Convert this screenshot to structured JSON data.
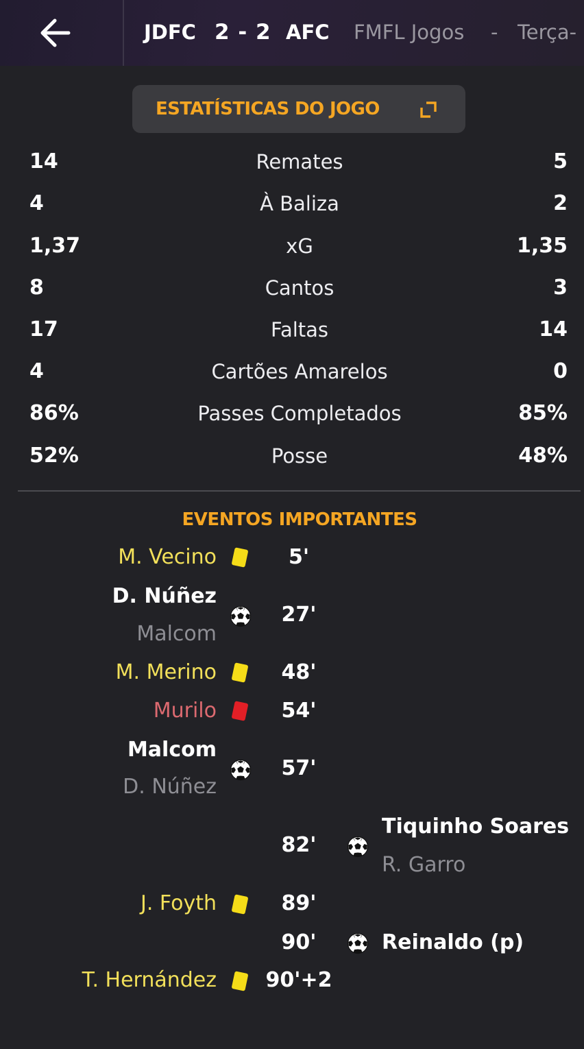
{
  "header": {
    "home_team": "JDFC",
    "score": "2 - 2",
    "away_team": "AFC",
    "competition": "FMFL Jogos",
    "separator": "-",
    "day": "Terça-"
  },
  "stats_tab": {
    "label": "ESTATÍSTICAS DO JOGO"
  },
  "stats": [
    {
      "label": "Remates",
      "home": "14",
      "away": "5"
    },
    {
      "label": "À Baliza",
      "home": "4",
      "away": "2"
    },
    {
      "label": "xG",
      "home": "1,37",
      "away": "1,35"
    },
    {
      "label": "Cantos",
      "home": "8",
      "away": "3"
    },
    {
      "label": "Faltas",
      "home": "17",
      "away": "14"
    },
    {
      "label": "Cartões Amarelos",
      "home": "4",
      "away": "0"
    },
    {
      "label": "Passes Completados",
      "home": "86%",
      "away": "85%"
    },
    {
      "label": "Posse",
      "home": "52%",
      "away": "48%"
    }
  ],
  "events_title": "EVENTOS IMPORTANTES",
  "events": [
    {
      "side": "home",
      "type": "yellow-card",
      "player": "M. Vecino",
      "time": "5'"
    },
    {
      "side": "home",
      "type": "goal",
      "player": "D. Núñez",
      "assist": "Malcom",
      "time": "27'"
    },
    {
      "side": "home",
      "type": "yellow-card",
      "player": "M. Merino",
      "time": "48'"
    },
    {
      "side": "home",
      "type": "red-card",
      "player": "Murilo",
      "time": "54'"
    },
    {
      "side": "home",
      "type": "goal",
      "player": "Malcom",
      "assist": "D. Núñez",
      "time": "57'"
    },
    {
      "side": "away",
      "type": "goal",
      "player": "Tiquinho Soares",
      "assist": "R. Garro",
      "time": "82'"
    },
    {
      "side": "home",
      "type": "yellow-card",
      "player": "J. Foyth",
      "time": "89'"
    },
    {
      "side": "away",
      "type": "goal",
      "player": "Reinaldo (p)",
      "time": "90'"
    },
    {
      "side": "home",
      "type": "yellow-card",
      "player": "T. Hernández",
      "time": "90'+2"
    }
  ],
  "colors": {
    "accent": "#f5a623",
    "yellow_card": "#f5dc18",
    "red_card": "#e21f26",
    "yellow_text": "#f2e05a",
    "red_text": "#dc6a70",
    "background": "#222226"
  },
  "icons": [
    "back-arrow-icon",
    "popout-icon",
    "yellow-card-icon",
    "red-card-icon",
    "soccer-ball-icon"
  ]
}
